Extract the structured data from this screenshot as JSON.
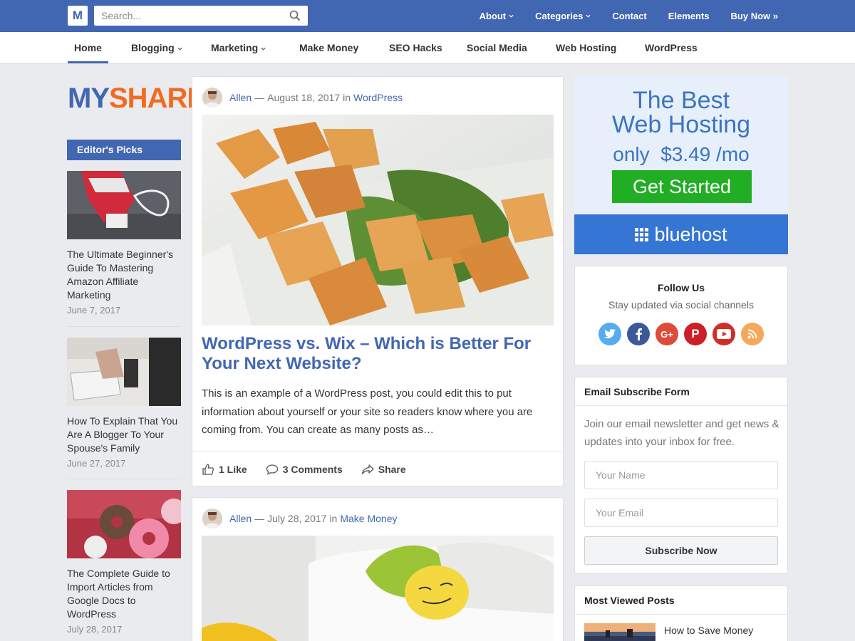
{
  "topbar": {
    "logo_letter": "M",
    "search_placeholder": "Search...",
    "nav": [
      {
        "label": "About",
        "dropdown": true
      },
      {
        "label": "Categories",
        "dropdown": true
      },
      {
        "label": "Contact",
        "dropdown": false
      },
      {
        "label": "Elements",
        "dropdown": false
      },
      {
        "label": "Buy Now »",
        "dropdown": false
      }
    ]
  },
  "subnav": {
    "items": [
      {
        "label": "Home",
        "active": true
      },
      {
        "label": "Blogging",
        "dropdown": true
      },
      {
        "label": "Marketing",
        "dropdown": true
      },
      {
        "label": "Make Money"
      },
      {
        "label": "SEO Hacks"
      },
      {
        "label": "Social Media"
      },
      {
        "label": "Web Hosting"
      },
      {
        "label": "WordPress"
      }
    ]
  },
  "sidebar_left": {
    "brand_part1": "MY",
    "brand_part2": "SHARE",
    "picks_title": "Editor's Picks",
    "picks": [
      {
        "title": "The Ultimate Beginner's Guide To Mastering Amazon Affiliate Marketing",
        "date": "June 7, 2017"
      },
      {
        "title": "How To Explain That You Are A Blogger To Your Spouse's Family",
        "date": "June 27, 2017"
      },
      {
        "title": "The Complete Guide to Import Articles from Google Docs to WordPress",
        "date": "July 28, 2017"
      }
    ]
  },
  "posts": [
    {
      "author": "Allen",
      "date": "August 18, 2017",
      "in_label": "in",
      "category": "WordPress",
      "title": "WordPress vs. Wix – Which is Better For Your Next Website?",
      "excerpt": "This is an example of a WordPress post, you could edit this to put information about yourself or your site so readers know where you are coming from. You can create as many posts as…",
      "likes": "1 Like",
      "comments": "3 Comments",
      "share": "Share"
    },
    {
      "author": "Allen",
      "date": "July 28, 2017",
      "in_label": "in",
      "category": "Make Money"
    }
  ],
  "ad": {
    "line1": "The Best",
    "line2": "Web Hosting",
    "line3": "only  $3.49 /mo",
    "cta": "Get Started",
    "brand": "bluehost"
  },
  "follow": {
    "title": "Follow Us",
    "subtitle": "Stay updated via social channels",
    "icons": [
      "twitter-icon",
      "facebook-icon",
      "google-plus-icon",
      "pinterest-icon",
      "youtube-icon",
      "rss-icon"
    ]
  },
  "subscribe": {
    "title": "Email Subscribe Form",
    "description": "Join our email newsletter and get news & updates into your inbox for free.",
    "name_placeholder": "Your Name",
    "email_placeholder": "Your Email",
    "button": "Subscribe Now"
  },
  "most_viewed": {
    "title": "Most Viewed Posts",
    "items": [
      {
        "title": "How to Save Money"
      }
    ]
  },
  "colors": {
    "primary": "#4267b2",
    "brand_orange": "#f26b21",
    "background": "#e9ebee",
    "cta_green": "#21ad24",
    "bluehost_blue": "#3575d3"
  }
}
